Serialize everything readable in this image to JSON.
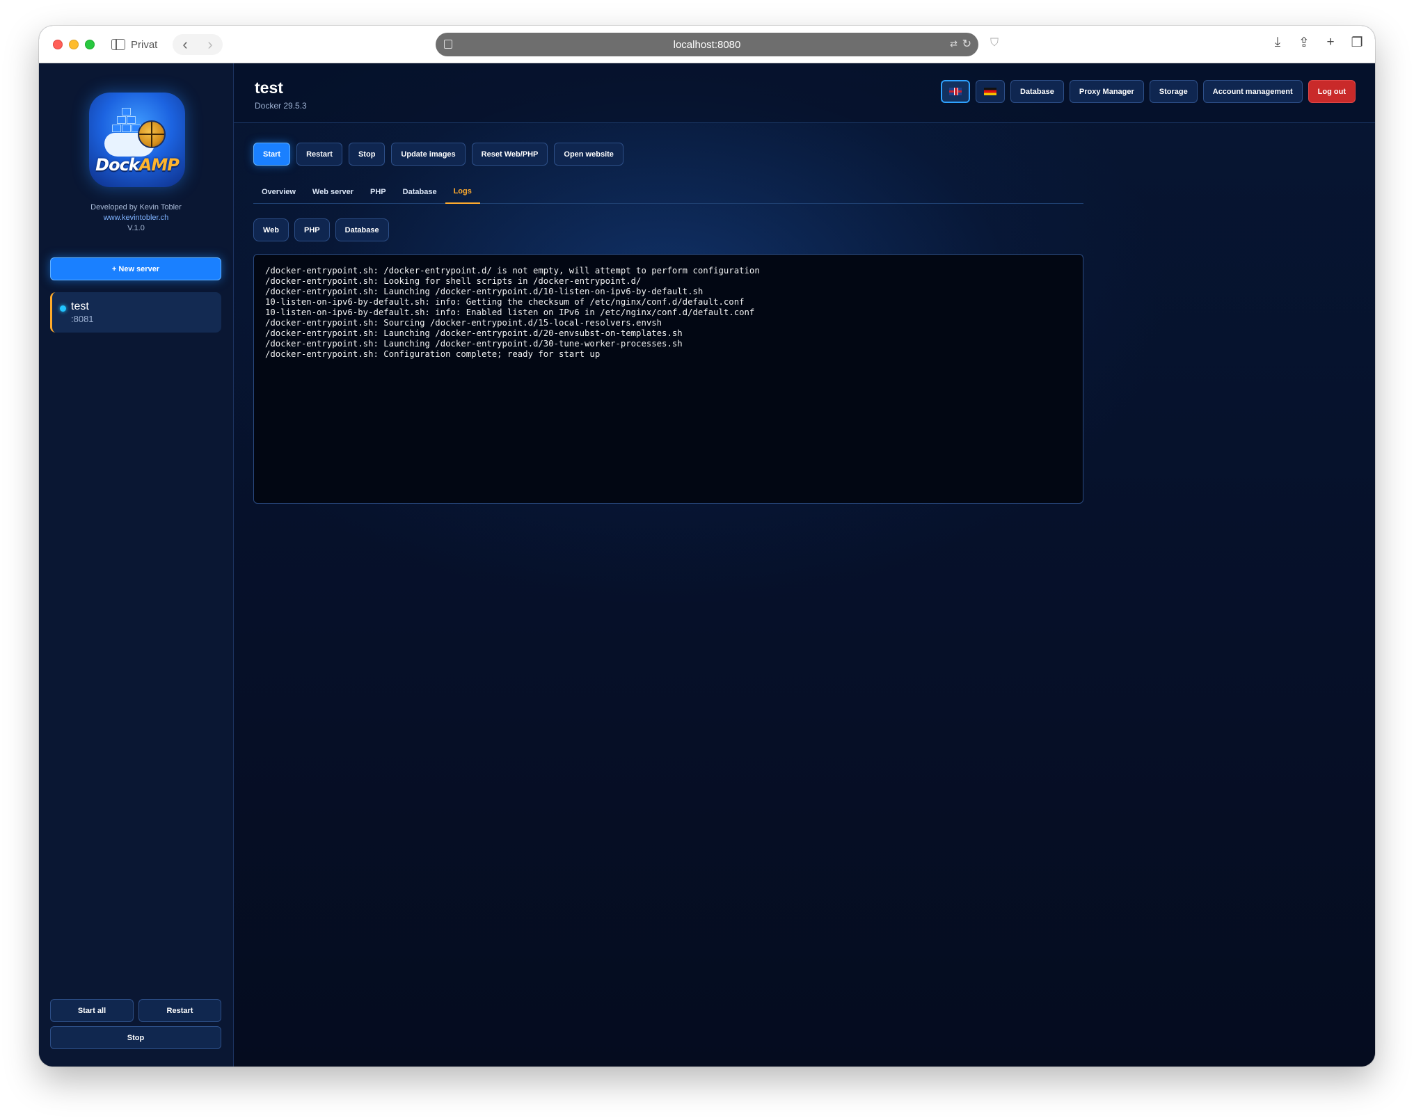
{
  "browser": {
    "profile_label": "Privat",
    "url": "localhost:8080"
  },
  "sidebar": {
    "logo_text_1": "Dock",
    "logo_text_2": "AMP",
    "developer": "Developed by Kevin Tobler",
    "website": "www.kevintobler.ch",
    "version": "V.1.0",
    "new_server_label": "+ New server",
    "servers": [
      {
        "name": "test",
        "port": ":8081",
        "status_color": "#22c4ff"
      }
    ],
    "start_all_label": "Start all",
    "restart_label": "Restart",
    "stop_label": "Stop"
  },
  "header": {
    "title": "test",
    "subtitle": "Docker 29.5.3",
    "nav": {
      "database": "Database",
      "proxy_manager": "Proxy Manager",
      "storage": "Storage",
      "account_management": "Account management",
      "logout": "Log out"
    },
    "languages": [
      "en",
      "de"
    ],
    "active_language": "en"
  },
  "actions": {
    "start": "Start",
    "restart": "Restart",
    "stop": "Stop",
    "update_images": "Update images",
    "reset_web_php": "Reset Web/PHP",
    "open_website": "Open website"
  },
  "tabs": {
    "overview": "Overview",
    "web_server": "Web server",
    "php": "PHP",
    "database": "Database",
    "logs": "Logs",
    "active": "logs"
  },
  "log_tabs": {
    "web": "Web",
    "php": "PHP",
    "database": "Database"
  },
  "logs": [
    "/docker-entrypoint.sh: /docker-entrypoint.d/ is not empty, will attempt to perform configuration",
    "/docker-entrypoint.sh: Looking for shell scripts in /docker-entrypoint.d/",
    "/docker-entrypoint.sh: Launching /docker-entrypoint.d/10-listen-on-ipv6-by-default.sh",
    "10-listen-on-ipv6-by-default.sh: info: Getting the checksum of /etc/nginx/conf.d/default.conf",
    "10-listen-on-ipv6-by-default.sh: info: Enabled listen on IPv6 in /etc/nginx/conf.d/default.conf",
    "/docker-entrypoint.sh: Sourcing /docker-entrypoint.d/15-local-resolvers.envsh",
    "/docker-entrypoint.sh: Launching /docker-entrypoint.d/20-envsubst-on-templates.sh",
    "/docker-entrypoint.sh: Launching /docker-entrypoint.d/30-tune-worker-processes.sh",
    "/docker-entrypoint.sh: Configuration complete; ready for start up"
  ],
  "colors": {
    "accent": "#1a80ff",
    "active_tab": "#ffab2e",
    "danger": "#c92a2a",
    "background": "#061128"
  }
}
